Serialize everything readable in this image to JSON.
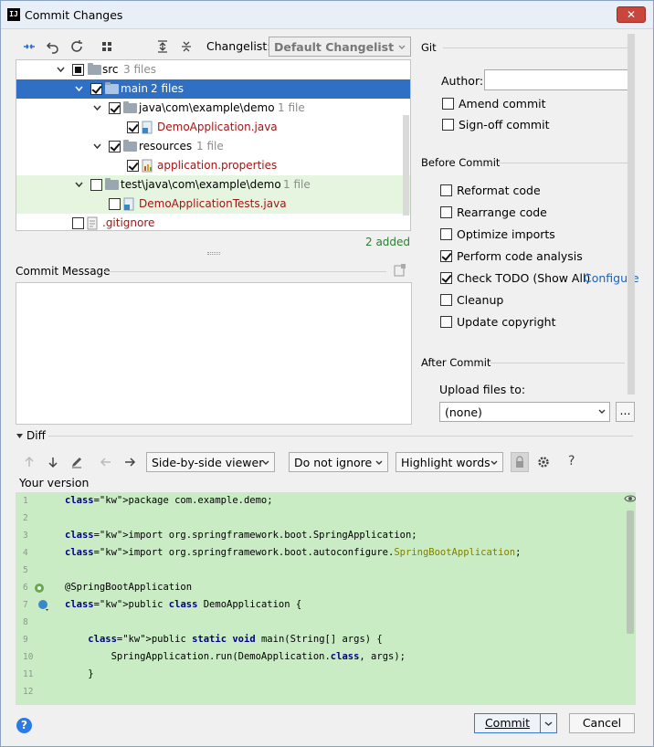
{
  "window": {
    "title": "Commit Changes",
    "app_icon": "IJ",
    "close_glyph": "✕"
  },
  "toolbar": {
    "changelist_label": "Changelist:",
    "changelist_value": "Default Changelist"
  },
  "tree": {
    "rows": [
      {
        "label": "src",
        "count": "3 files"
      },
      {
        "label": "main",
        "count": "2 files"
      },
      {
        "label": "java\\com\\example\\demo",
        "count": "1 file"
      },
      {
        "label": "DemoApplication.java",
        "count": ""
      },
      {
        "label": "resources",
        "count": "1 file"
      },
      {
        "label": "application.properties",
        "count": ""
      },
      {
        "label": "test\\java\\com\\example\\demo",
        "count": "1 file"
      },
      {
        "label": "DemoApplicationTests.java",
        "count": ""
      },
      {
        "label": ".gitignore",
        "count": ""
      }
    ],
    "summary": "2 added"
  },
  "commit_message": {
    "label": "Commit Message",
    "value": ""
  },
  "git": {
    "section_title": "Git",
    "author_label": "Author:",
    "author_value": "",
    "amend_label": "Amend commit",
    "signoff_label": "Sign-off commit"
  },
  "before_commit": {
    "section_title": "Before Commit",
    "options": [
      {
        "label": "Reformat code",
        "checked": false
      },
      {
        "label": "Rearrange code",
        "checked": false
      },
      {
        "label": "Optimize imports",
        "checked": false
      },
      {
        "label": "Perform code analysis",
        "checked": true
      },
      {
        "label": "Check TODO (Show All)",
        "checked": true
      },
      {
        "label": "Cleanup",
        "checked": false
      },
      {
        "label": "Update copyright",
        "checked": false
      }
    ],
    "configure_link": "Configure"
  },
  "after_commit": {
    "section_title": "After Commit",
    "upload_label": "Upload files to:",
    "upload_value": "(none)",
    "browse_label": "..."
  },
  "diff": {
    "label": "Diff",
    "viewer_mode": "Side-by-side viewer",
    "whitespace": "Do not ignore",
    "highlight": "Highlight words",
    "help_glyph": "?",
    "version_label": "Your version"
  },
  "code_lines": [
    {
      "n": "1",
      "t": "package com.example.demo;"
    },
    {
      "n": "2",
      "t": ""
    },
    {
      "n": "3",
      "t": "import org.springframework.boot.SpringApplication;"
    },
    {
      "n": "4",
      "t": "import org.springframework.boot.autoconfigure.SpringBootApplication;"
    },
    {
      "n": "5",
      "t": ""
    },
    {
      "n": "6",
      "t": "@SpringBootApplication"
    },
    {
      "n": "7",
      "t": "public class DemoApplication {"
    },
    {
      "n": "8",
      "t": ""
    },
    {
      "n": "9",
      "t": "    public static void main(String[] args) {"
    },
    {
      "n": "10",
      "t": "        SpringApplication.run(DemoApplication.class, args);"
    },
    {
      "n": "11",
      "t": "    }"
    },
    {
      "n": "12",
      "t": ""
    }
  ],
  "footer": {
    "commit_label": "Commit",
    "cancel_label": "Cancel",
    "help_glyph": "?"
  }
}
